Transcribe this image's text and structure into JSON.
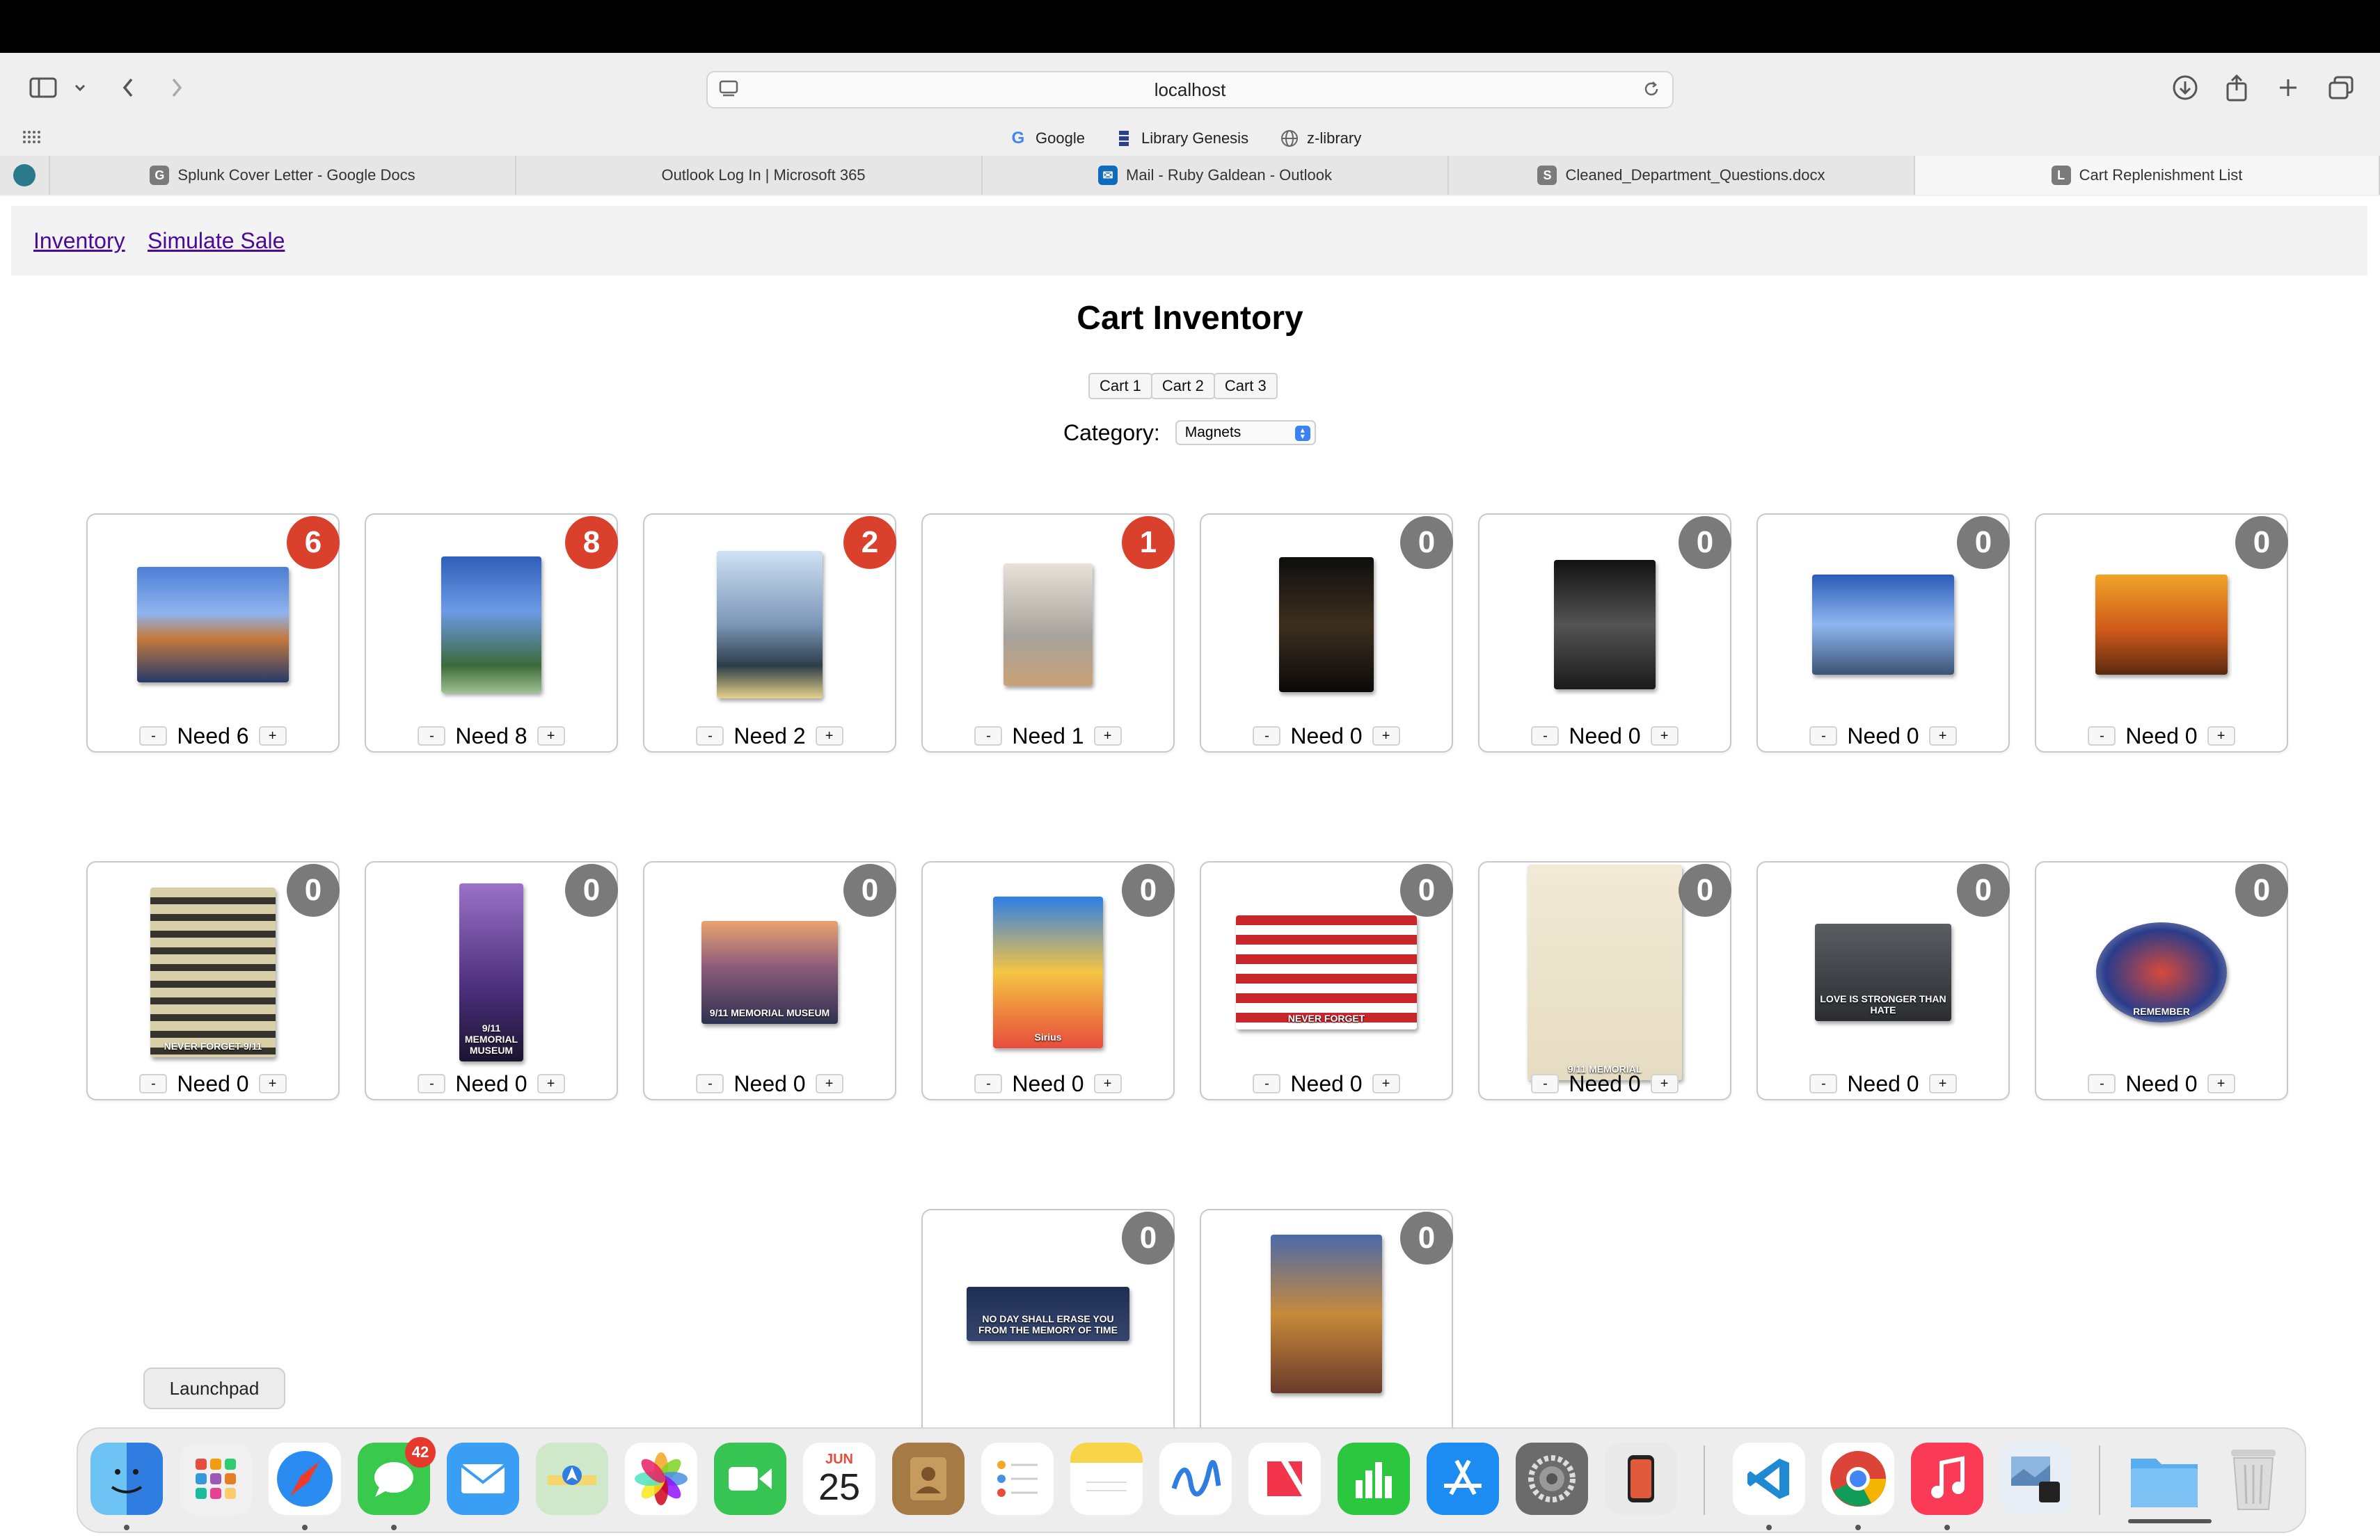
{
  "browser": {
    "url": "localhost",
    "bookmarks": [
      {
        "label": "Google",
        "icon": "google-icon"
      },
      {
        "label": "Library Genesis",
        "icon": "library-icon"
      },
      {
        "label": "z-library",
        "icon": "globe-icon"
      }
    ],
    "tabs": [
      {
        "label": "Splunk Cover Letter - Google Docs",
        "favicon": "G",
        "color": "#7a7a7a"
      },
      {
        "label": "Outlook Log In | Microsoft 365",
        "favicon": "",
        "color": "#f25022"
      },
      {
        "label": "Mail - Ruby Galdean - Outlook",
        "favicon": "",
        "color": "#0f6cbd"
      },
      {
        "label": "Cleaned_Department_Questions.docx",
        "favicon": "S",
        "color": "#7a7a7a"
      },
      {
        "label": "Cart Replenishment List",
        "favicon": "L",
        "color": "#7a7a7a",
        "active": true
      }
    ]
  },
  "nav": {
    "inventory": "Inventory",
    "simulate_sale": "Simulate Sale"
  },
  "page": {
    "title": "Cart Inventory",
    "carts": [
      "Cart 1",
      "Cart 2",
      "Cart 3"
    ],
    "category_label": "Category:",
    "category_value": "Magnets"
  },
  "items": [
    {
      "need": 6,
      "need_text": "Need 6",
      "badge": "6",
      "status": "red"
    },
    {
      "need": 8,
      "need_text": "Need 8",
      "badge": "8",
      "status": "red"
    },
    {
      "need": 2,
      "need_text": "Need 2",
      "badge": "2",
      "status": "red"
    },
    {
      "need": 1,
      "need_text": "Need 1",
      "badge": "1",
      "status": "red"
    },
    {
      "need": 0,
      "need_text": "Need 0",
      "badge": "0",
      "status": "grey"
    },
    {
      "need": 0,
      "need_text": "Need 0",
      "badge": "0",
      "status": "grey"
    },
    {
      "need": 0,
      "need_text": "Need 0",
      "badge": "0",
      "status": "grey"
    },
    {
      "need": 0,
      "need_text": "Need 0",
      "badge": "0",
      "status": "grey"
    },
    {
      "need": 0,
      "need_text": "Need 0",
      "badge": "0",
      "status": "grey",
      "img_text": "NEVER FORGET 9/11"
    },
    {
      "need": 0,
      "need_text": "Need 0",
      "badge": "0",
      "status": "grey",
      "img_text": "9/11 MEMORIAL MUSEUM"
    },
    {
      "need": 0,
      "need_text": "Need 0",
      "badge": "0",
      "status": "grey",
      "img_text": "9/11 MEMORIAL MUSEUM"
    },
    {
      "need": 0,
      "need_text": "Need 0",
      "badge": "0",
      "status": "grey",
      "img_text": "Sirius"
    },
    {
      "need": 0,
      "need_text": "Need 0",
      "badge": "0",
      "status": "grey",
      "img_text": "NEVER FORGET"
    },
    {
      "need": 0,
      "need_text": "Need 0",
      "badge": "0",
      "status": "grey",
      "img_text": "9/11 MEMORIAL"
    },
    {
      "need": 0,
      "need_text": "Need 0",
      "badge": "0",
      "status": "grey",
      "img_text": "LOVE IS STRONGER THAN HATE"
    },
    {
      "need": 0,
      "need_text": "Need 0",
      "badge": "0",
      "status": "grey",
      "img_text": "REMEMBER"
    },
    {
      "need": 0,
      "need_text": "",
      "badge": "0",
      "status": "grey",
      "img_text": "NO DAY SHALL ERASE YOU FROM THE MEMORY OF TIME"
    },
    {
      "need": 0,
      "need_text": "",
      "badge": "0",
      "status": "grey"
    }
  ],
  "controls": {
    "minus": "-",
    "plus": "+"
  },
  "dock": {
    "tooltip": "Launchpad",
    "messages_badge": "42",
    "calendar_month": "JUN",
    "calendar_day": "25"
  }
}
